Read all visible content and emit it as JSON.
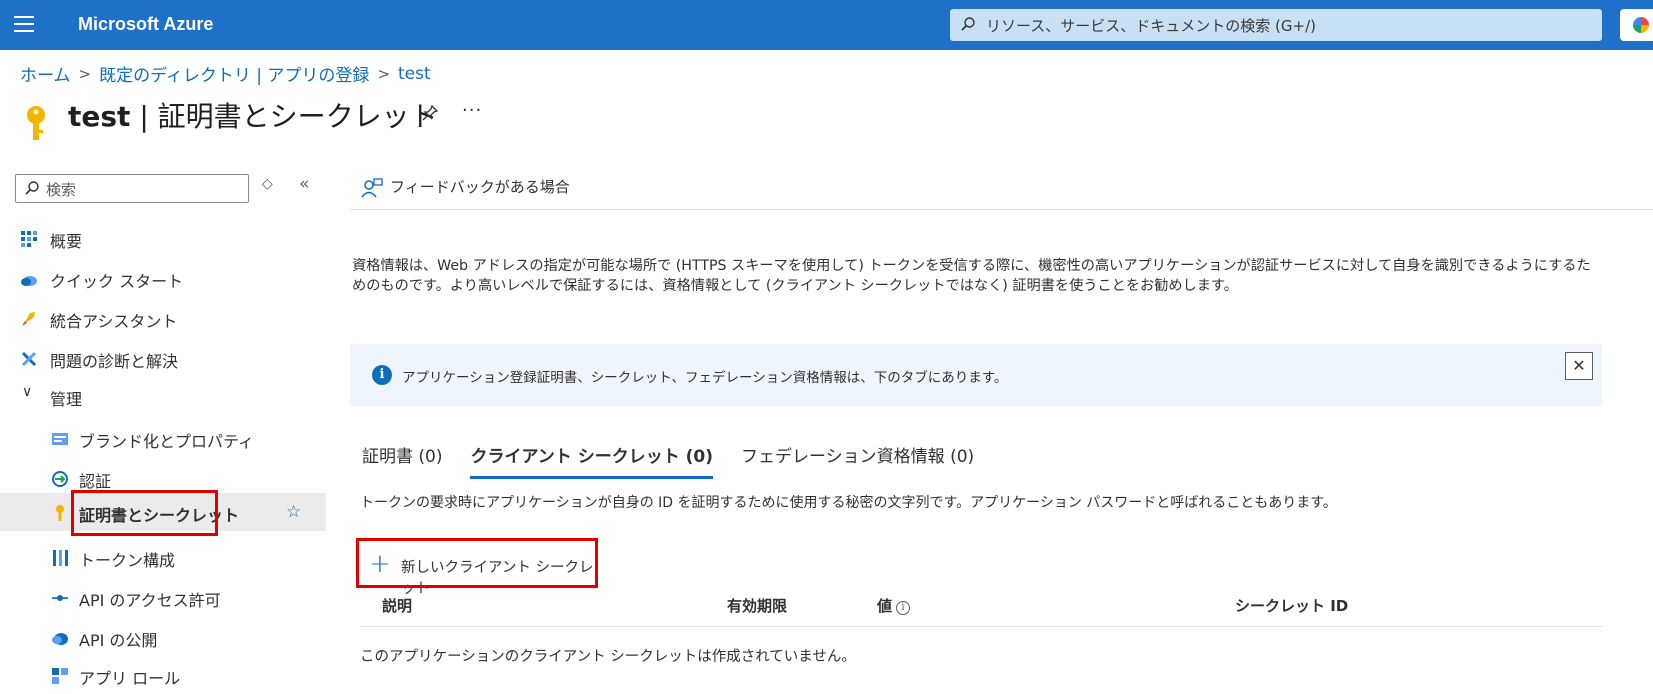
{
  "topbar": {
    "brand": "Microsoft Azure",
    "search_placeholder": "リソース、サービス、ドキュメントの検索 (G+/)"
  },
  "breadcrumb": {
    "items": [
      "ホーム",
      "既定のディレクトリ | アプリの登録",
      "test"
    ],
    "separator": ">"
  },
  "header": {
    "title_bold": "test",
    "title_rest": " | 証明書とシークレット",
    "more": "···"
  },
  "sidebar": {
    "search_placeholder": "検索",
    "items": [
      {
        "label": "概要"
      },
      {
        "label": "クイック スタート"
      },
      {
        "label": "統合アシスタント"
      },
      {
        "label": "問題の診断と解決"
      },
      {
        "label": "管理"
      },
      {
        "label": "ブランド化とプロパティ"
      },
      {
        "label": "認証"
      },
      {
        "label": "証明書とシークレット"
      },
      {
        "label": "トークン構成"
      },
      {
        "label": "API のアクセス許可"
      },
      {
        "label": "API の公開"
      },
      {
        "label": "アプリ ロール"
      }
    ]
  },
  "main": {
    "feedback": "フィードバックがある場合",
    "description": "資格情報は、Web アドレスの指定が可能な場所で (HTTPS スキーマを使用して) トークンを受信する際に、機密性の高いアプリケーションが認証サービスに対して自身を識別できるようにするためのものです。より高いレベルで保証するには、資格情報として (クライアント シークレットではなく) 証明書を使うことをお勧めします。",
    "info_banner": "アプリケーション登録証明書、シークレット、フェデレーション資格情報は、下のタブにあります。",
    "tabs": [
      {
        "label": "証明書 (0)"
      },
      {
        "label": "クライアント シークレット (0)"
      },
      {
        "label": "フェデレーション資格情報 (0)"
      }
    ],
    "tab_description": "トークンの要求時にアプリケーションが自身の ID を証明するために使用する秘密の文字列です。アプリケーション パスワードと呼ばれることもあります。",
    "new_secret_button": "新しいクライアント シークレット",
    "table": {
      "columns": [
        "説明",
        "有効期限",
        "値",
        "シークレット ID"
      ],
      "empty_text": "このアプリケーションのクライアント シークレットは作成されていません。"
    }
  },
  "colors": {
    "topbar": "#1e70c8",
    "accent": "#0f6cbd",
    "highlight_box": "#e00000"
  }
}
